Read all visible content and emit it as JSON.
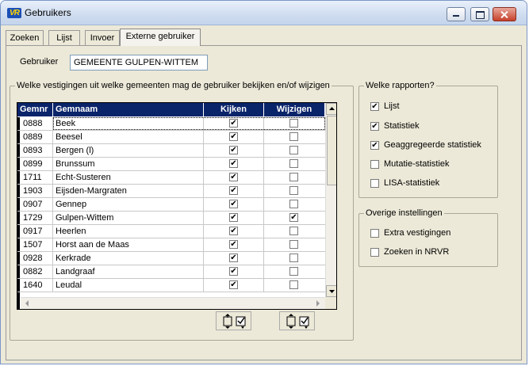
{
  "window": {
    "title": "Gebruikers",
    "app_icon_text": "VR"
  },
  "tabs": [
    {
      "label": "Zoeken",
      "active": false
    },
    {
      "label": "Lijst",
      "active": false
    },
    {
      "label": "Invoer",
      "active": false
    },
    {
      "label": "Externe gebruiker",
      "active": true
    }
  ],
  "user": {
    "label": "Gebruiker",
    "value": "GEMEENTE GULPEN-WITTEM"
  },
  "vestigingen_group": {
    "title": "Welke vestigingen uit welke gemeenten mag de gebruiker bekijken en/of wijzigen",
    "columns": [
      "Gemnr",
      "Gemnaam",
      "Kijken",
      "Wijzigen"
    ],
    "rows": [
      {
        "gemnr": "0888",
        "gemnaam": "Beek",
        "kijken": true,
        "wijzigen": false
      },
      {
        "gemnr": "0889",
        "gemnaam": "Beesel",
        "kijken": true,
        "wijzigen": false
      },
      {
        "gemnr": "0893",
        "gemnaam": "Bergen (l)",
        "kijken": true,
        "wijzigen": false
      },
      {
        "gemnr": "0899",
        "gemnaam": "Brunssum",
        "kijken": true,
        "wijzigen": false
      },
      {
        "gemnr": "1711",
        "gemnaam": "Echt-Susteren",
        "kijken": true,
        "wijzigen": false
      },
      {
        "gemnr": "1903",
        "gemnaam": "Eijsden-Margraten",
        "kijken": true,
        "wijzigen": false
      },
      {
        "gemnr": "0907",
        "gemnaam": "Gennep",
        "kijken": true,
        "wijzigen": false
      },
      {
        "gemnr": "1729",
        "gemnaam": "Gulpen-Wittem",
        "kijken": true,
        "wijzigen": true
      },
      {
        "gemnr": "0917",
        "gemnaam": "Heerlen",
        "kijken": true,
        "wijzigen": false
      },
      {
        "gemnr": "1507",
        "gemnaam": "Horst aan de Maas",
        "kijken": true,
        "wijzigen": false
      },
      {
        "gemnr": "0928",
        "gemnaam": "Kerkrade",
        "kijken": true,
        "wijzigen": false
      },
      {
        "gemnr": "0882",
        "gemnaam": "Landgraaf",
        "kijken": true,
        "wijzigen": false
      },
      {
        "gemnr": "1640",
        "gemnaam": "Leudal",
        "kijken": true,
        "wijzigen": false
      }
    ]
  },
  "rapporten_group": {
    "title": "Welke rapporten?",
    "items": [
      {
        "label": "Lijst",
        "checked": true
      },
      {
        "label": "Statistiek",
        "checked": true
      },
      {
        "label": "Geaggregeerde statistiek",
        "checked": true
      },
      {
        "label": "Mutatie-statistiek",
        "checked": false
      },
      {
        "label": "LISA-statistiek",
        "checked": false
      }
    ]
  },
  "overige_group": {
    "title": "Overige instellingen",
    "items": [
      {
        "label": "Extra vestigingen",
        "checked": false
      },
      {
        "label": "Zoeken in NRVR",
        "checked": false
      }
    ]
  },
  "colors": {
    "grid_header_bg": "#0a246a",
    "window_bg": "#ece9d8",
    "close_button": "#c7402b"
  },
  "icons": {
    "toggle_kijken": "toggle-all-checkbox-icon",
    "toggle_wijzigen": "toggle-all-checkbox-icon"
  }
}
